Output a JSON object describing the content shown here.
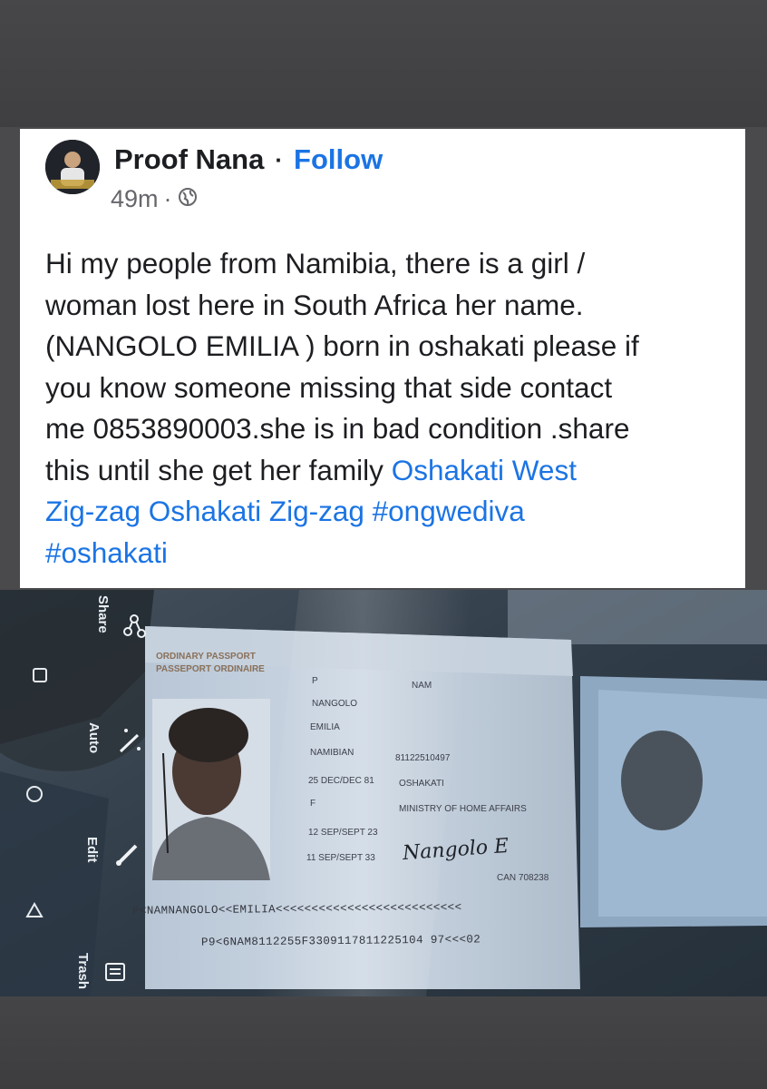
{
  "post": {
    "author": "Proof Nana",
    "separator": "·",
    "follow_label": "Follow",
    "time": "49m",
    "visibility_icon": "globe-icon",
    "text_lines": [
      "Hi my people from Namibia, there is a girl /",
      "woman lost here in South Africa her name.",
      "(NANGOLO EMILIA ) born in oshakati please if",
      "you know someone missing that side contact",
      "me 0853890003.she is in bad condition .share"
    ],
    "last_line_text": "this until she get her family",
    "links": {
      "oshakati_west": "Oshakati West",
      "zigzag_line": "Zig-zag Oshakati Zig-zag #ongwediva",
      "hashtag_oshakati": "#oshakati"
    }
  },
  "photo_viewer": {
    "actions": [
      {
        "label": "Share",
        "icon": "share-icon"
      },
      {
        "label": "Auto",
        "icon": "magic-wand-icon"
      },
      {
        "label": "Edit",
        "icon": "pencil-icon"
      },
      {
        "label": "Trash",
        "icon": "trash-icon"
      }
    ],
    "nav_icons": [
      "recent-apps-icon",
      "home-icon",
      "back-icon"
    ]
  },
  "passport": {
    "header_1": "ORDINARY PASSPORT",
    "header_2": "PASSEPORT ORDINAIRE",
    "type": "P",
    "code": "NAM",
    "surname": "NANGOLO",
    "given_names": "EMILIA",
    "nationality": "NAMIBIAN",
    "personal_no": "81122510497",
    "dob": "25 DEC/DEC 81",
    "birth_place": "OSHAKATI",
    "sex": "F",
    "authority": "MINISTRY OF HOME AFFAIRS",
    "issue_date": "12 SEP/SEPT 23",
    "expiry_date": "11 SEP/SEPT 33",
    "signature": "Nangolo E",
    "can": "CAN 708238",
    "mrz_1": "P<NAMNANGOLO<<EMILIA<<<<<<<<<<<<<<<<<<<<<<<<<<",
    "mrz_2": "P9<6NAM8112255F3309117811225104 97<<<02"
  }
}
